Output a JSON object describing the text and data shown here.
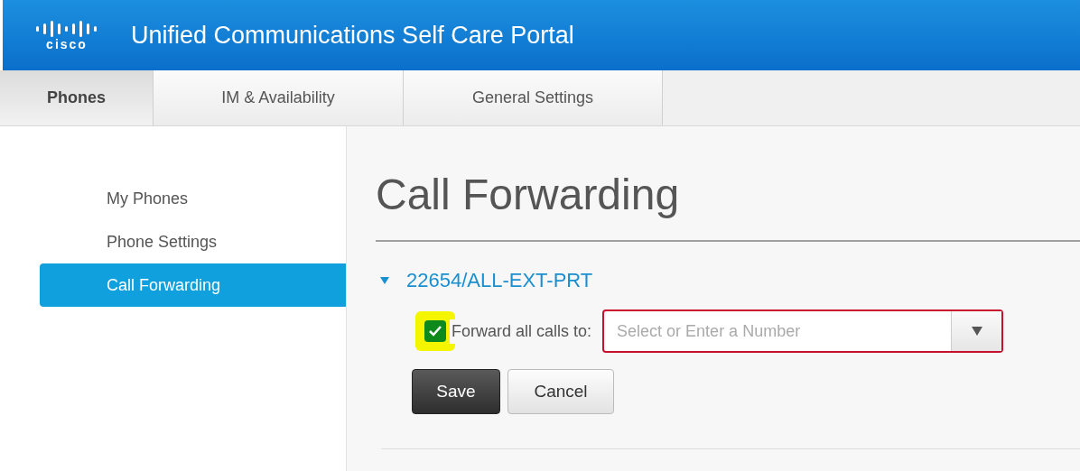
{
  "header": {
    "logo_text": "cisco",
    "title": "Unified Communications Self Care Portal"
  },
  "tabs": [
    {
      "label": "Phones",
      "selected": true
    },
    {
      "label": "IM & Availability",
      "selected": false
    },
    {
      "label": "General Settings",
      "selected": false
    }
  ],
  "sidebar": {
    "items": [
      {
        "label": "My Phones",
        "selected": false
      },
      {
        "label": "Phone Settings",
        "selected": false
      },
      {
        "label": "Call Forwarding",
        "selected": true
      }
    ]
  },
  "page_title": "Call Forwarding",
  "line": {
    "label": "22654/ALL-EXT-PRT",
    "expanded": true
  },
  "forward_all": {
    "label": "Forward all calls to:",
    "checked": true,
    "highlighted": true,
    "placeholder": "Select or Enter a Number"
  },
  "buttons": [
    {
      "label": "Save",
      "kind": "primary"
    },
    {
      "label": "Cancel",
      "kind": "secondary"
    }
  ]
}
